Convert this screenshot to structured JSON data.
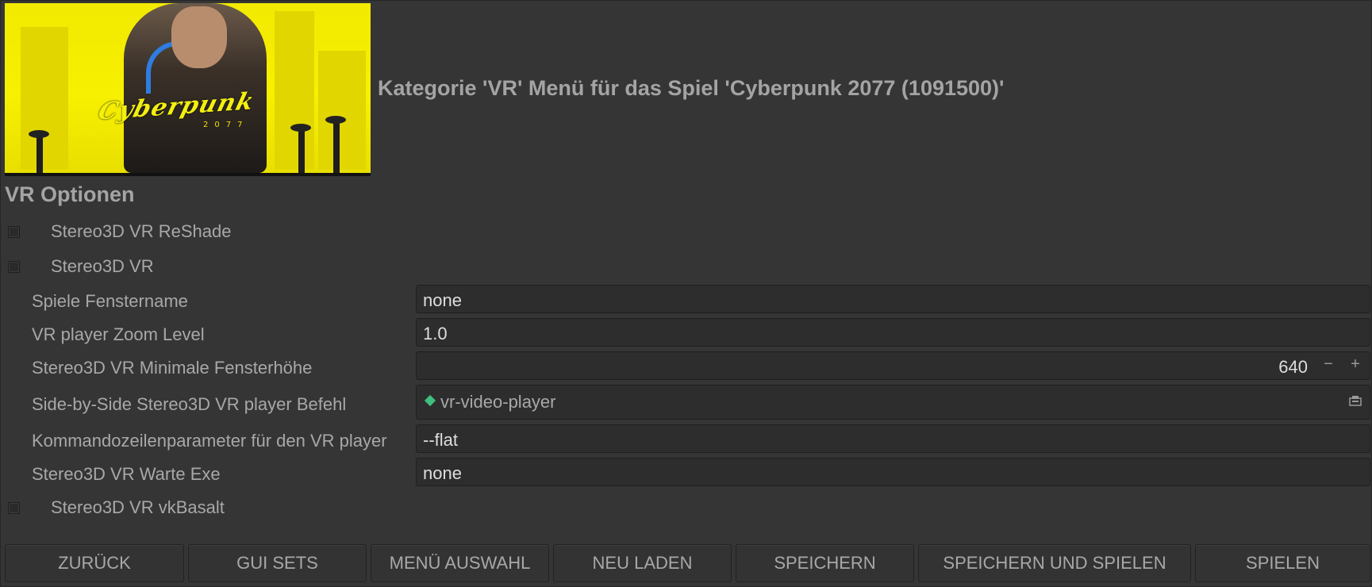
{
  "window": {
    "title": "Kategorie 'VR' Menü für das Spiel 'Cyberpunk 2077 (1091500)'"
  },
  "banner": {
    "logo_text": "Cyberpunk",
    "logo_year": "2077",
    "icon": "game-banner-image"
  },
  "section_title": "VR Optionen",
  "checkboxes": [
    {
      "label": "Stereo3D VR ReShade",
      "checked": false
    },
    {
      "label": "Stereo3D VR",
      "checked": false
    },
    {
      "label": "Stereo3D VR vkBasalt",
      "checked": false
    }
  ],
  "fields": [
    {
      "label": "Spiele Fenstername",
      "value": "none"
    },
    {
      "label": "VR player Zoom Level",
      "value": "1.0"
    },
    {
      "label": "Stereo3D VR Minimale Fensterhöhe",
      "value": "640",
      "minus": "−",
      "plus": "+"
    },
    {
      "label": "Side-by-Side Stereo3D VR player Befehl",
      "value": "vr-video-player",
      "icon": "file-chooser-icon"
    },
    {
      "label": "Kommandozeilenparameter für den VR player",
      "value": " --flat"
    },
    {
      "label": "Stereo3D VR Warte Exe",
      "value": "none"
    }
  ],
  "buttons": [
    {
      "label": "ZURÜCK"
    },
    {
      "label": "GUI SETS"
    },
    {
      "label": "MENÜ AUSWAHL"
    },
    {
      "label": "NEU LADEN"
    },
    {
      "label": "SPEICHERN"
    },
    {
      "label": "SPEICHERN UND SPIELEN"
    },
    {
      "label": "SPIELEN"
    }
  ],
  "colors": {
    "background": "#353535",
    "banner_yellow": "#f7f000",
    "accent_green": "#3fbf7f"
  }
}
